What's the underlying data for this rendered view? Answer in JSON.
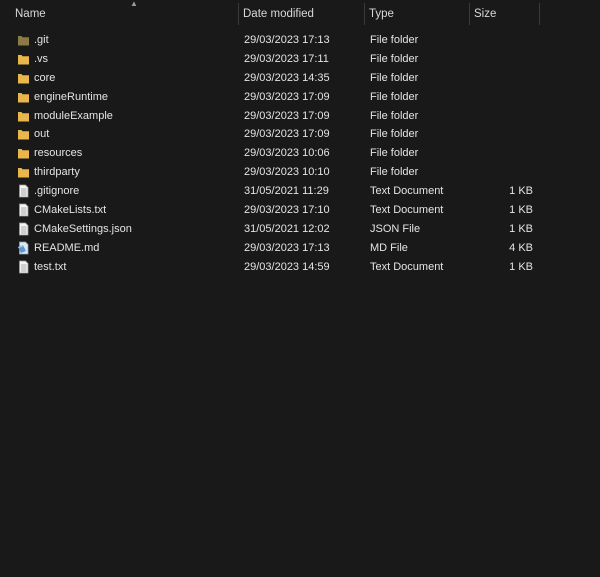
{
  "columns": {
    "name": "Name",
    "date": "Date modified",
    "type": "Type",
    "size": "Size"
  },
  "colors": {
    "background": "#191919",
    "folder": "#e8b64a",
    "git_folder": "#8c7a45"
  },
  "files": [
    {
      "name": ".git",
      "date": "29/03/2023 17:13",
      "type": "File folder",
      "size": "",
      "icon": "git-folder-icon"
    },
    {
      "name": ".vs",
      "date": "29/03/2023 17:11",
      "type": "File folder",
      "size": "",
      "icon": "folder-icon"
    },
    {
      "name": "core",
      "date": "29/03/2023 14:35",
      "type": "File folder",
      "size": "",
      "icon": "folder-icon"
    },
    {
      "name": "engineRuntime",
      "date": "29/03/2023 17:09",
      "type": "File folder",
      "size": "",
      "icon": "folder-icon"
    },
    {
      "name": "moduleExample",
      "date": "29/03/2023 17:09",
      "type": "File folder",
      "size": "",
      "icon": "folder-icon"
    },
    {
      "name": "out",
      "date": "29/03/2023 17:09",
      "type": "File folder",
      "size": "",
      "icon": "folder-icon"
    },
    {
      "name": "resources",
      "date": "29/03/2023 10:06",
      "type": "File folder",
      "size": "",
      "icon": "folder-icon"
    },
    {
      "name": "thirdparty",
      "date": "29/03/2023 10:10",
      "type": "File folder",
      "size": "",
      "icon": "folder-icon"
    },
    {
      "name": ".gitignore",
      "date": "31/05/2021 11:29",
      "type": "Text Document",
      "size": "1 KB",
      "icon": "text-document-icon"
    },
    {
      "name": "CMakeLists.txt",
      "date": "29/03/2023 17:10",
      "type": "Text Document",
      "size": "1 KB",
      "icon": "text-document-icon"
    },
    {
      "name": "CMakeSettings.json",
      "date": "31/05/2021 12:02",
      "type": "JSON File",
      "size": "1 KB",
      "icon": "text-document-icon"
    },
    {
      "name": "README.md",
      "date": "29/03/2023 17:13",
      "type": "MD File",
      "size": "4 KB",
      "icon": "markdown-file-icon"
    },
    {
      "name": "test.txt",
      "date": "29/03/2023 14:59",
      "type": "Text Document",
      "size": "1 KB",
      "icon": "text-document-icon"
    }
  ]
}
